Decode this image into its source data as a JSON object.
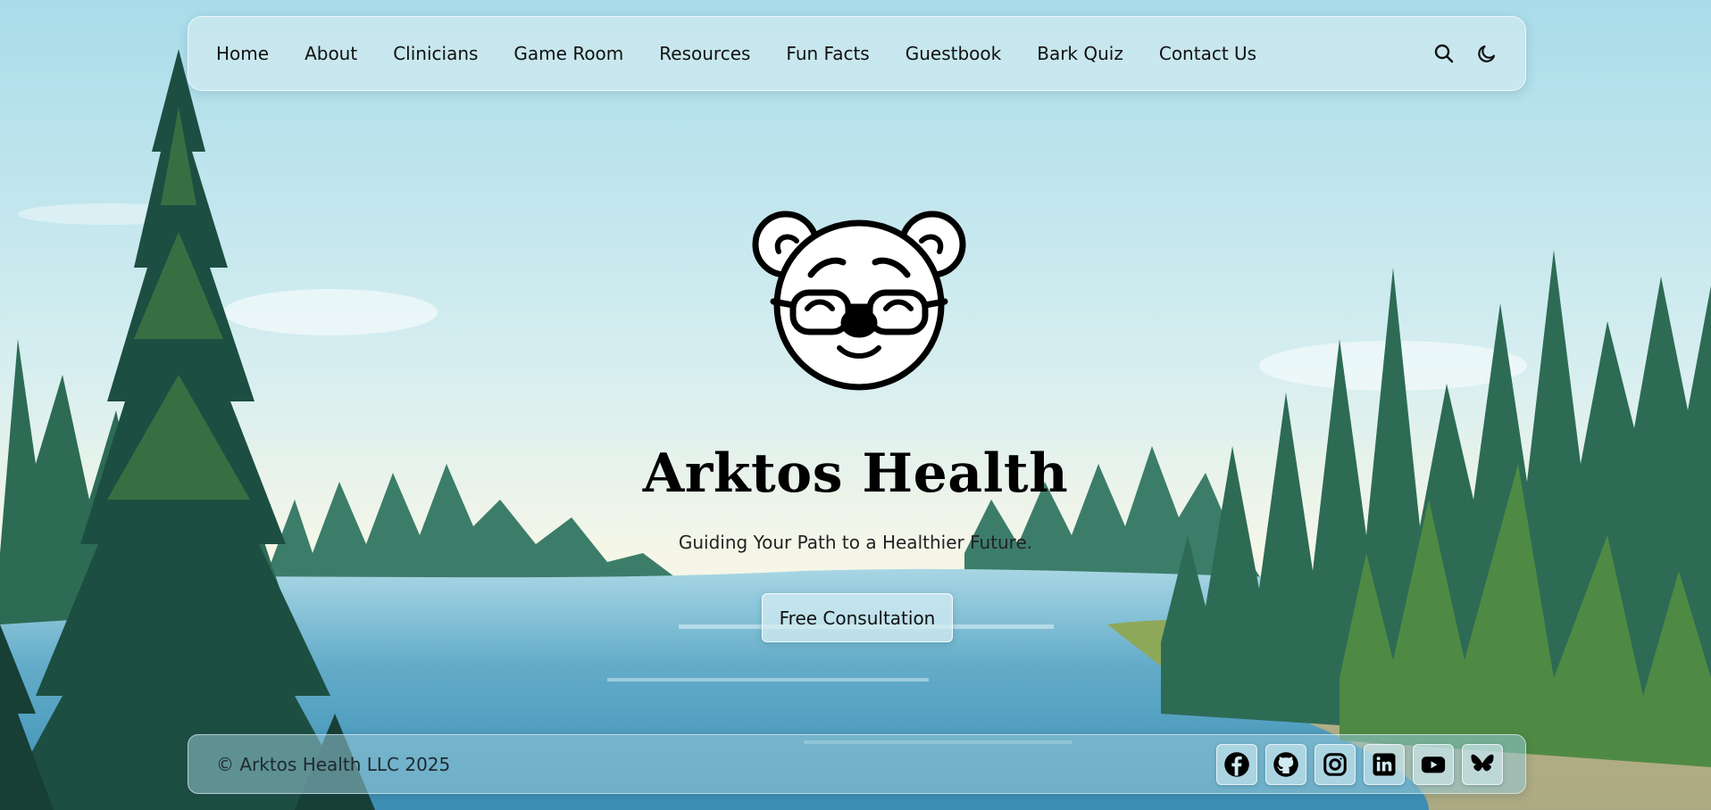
{
  "nav": {
    "links": [
      "Home",
      "About",
      "Clinicians",
      "Game Room",
      "Resources",
      "Fun Facts",
      "Guestbook",
      "Bark Quiz",
      "Contact Us"
    ],
    "tools": [
      "search-icon",
      "moon-icon"
    ]
  },
  "hero": {
    "title": "Arktos Health",
    "subtitle": "Guiding Your Path to a Healthier Future.",
    "cta_label": "Free Consultation"
  },
  "footer": {
    "copyright": "© Arktos Health LLC 2025",
    "socials": [
      "facebook-icon",
      "github-icon",
      "instagram-icon",
      "linkedin-icon",
      "youtube-icon",
      "bluesky-icon"
    ]
  },
  "colors": {
    "sky_top": "#a9dcea",
    "sky_horizon": "#f5f6e8",
    "water": "#4f9ec0",
    "forest_dark": "#1f5e4e",
    "forest_light": "#4f8a44"
  }
}
